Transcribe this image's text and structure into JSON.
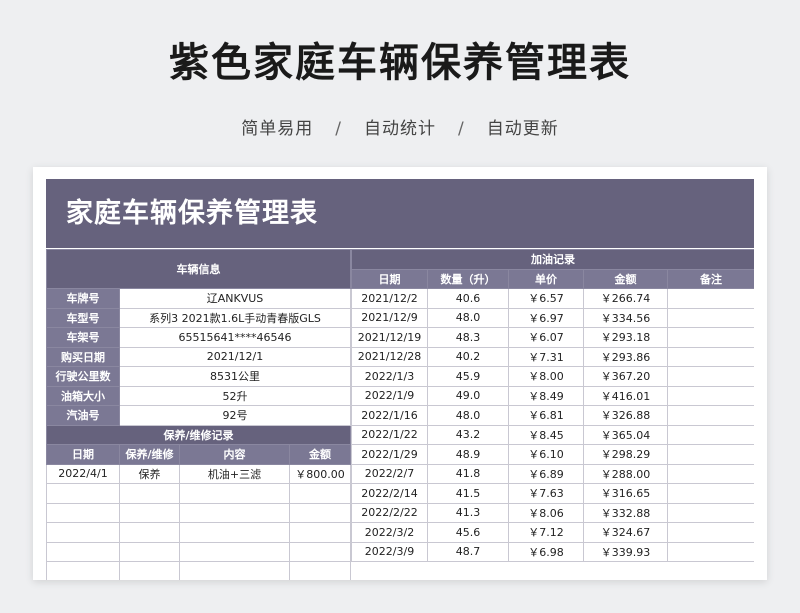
{
  "header": {
    "title": "紫色家庭车辆保养管理表",
    "features": [
      "简单易用",
      "自动统计",
      "自动更新"
    ],
    "separator": "/"
  },
  "sheet": {
    "title": "家庭车辆保养管理表",
    "vehicle_section": "车辆信息",
    "vehicle_info": [
      {
        "label": "车牌号",
        "value": "辽ANKVUS"
      },
      {
        "label": "车型号",
        "value": "系列3 2021款1.6L手动青春版GLS"
      },
      {
        "label": "车架号",
        "value": "65515641****46546"
      },
      {
        "label": "购买日期",
        "value": "2021/12/1"
      },
      {
        "label": "行驶公里数",
        "value": "8531公里"
      },
      {
        "label": "油箱大小",
        "value": "52升"
      },
      {
        "label": "汽油号",
        "value": "92号"
      }
    ],
    "maintenance_section": "保养/维修记录",
    "maintenance_headers": [
      "日期",
      "保养/维修",
      "内容",
      "金额"
    ],
    "maintenance_rows": [
      {
        "date": "2022/4/1",
        "type": "保养",
        "content": "机油+三滤",
        "amount": "￥800.00"
      }
    ],
    "fuel_section": "加油记录",
    "fuel_headers": [
      "日期",
      "数量（升）",
      "单价",
      "金额",
      "备注"
    ],
    "fuel_rows": [
      {
        "date": "2021/12/2",
        "qty": "40.6",
        "price": "￥6.57",
        "amount": "￥266.74"
      },
      {
        "date": "2021/12/9",
        "qty": "48.0",
        "price": "￥6.97",
        "amount": "￥334.56"
      },
      {
        "date": "2021/12/19",
        "qty": "48.3",
        "price": "￥6.07",
        "amount": "￥293.18"
      },
      {
        "date": "2021/12/28",
        "qty": "40.2",
        "price": "￥7.31",
        "amount": "￥293.86"
      },
      {
        "date": "2022/1/3",
        "qty": "45.9",
        "price": "￥8.00",
        "amount": "￥367.20"
      },
      {
        "date": "2022/1/9",
        "qty": "49.0",
        "price": "￥8.49",
        "amount": "￥416.01"
      },
      {
        "date": "2022/1/16",
        "qty": "48.0",
        "price": "￥6.81",
        "amount": "￥326.88"
      },
      {
        "date": "2022/1/22",
        "qty": "43.2",
        "price": "￥8.45",
        "amount": "￥365.04"
      },
      {
        "date": "2022/1/29",
        "qty": "48.9",
        "price": "￥6.10",
        "amount": "￥298.29"
      },
      {
        "date": "2022/2/7",
        "qty": "41.8",
        "price": "￥6.89",
        "amount": "￥288.00"
      },
      {
        "date": "2022/2/14",
        "qty": "41.5",
        "price": "￥7.63",
        "amount": "￥316.65"
      },
      {
        "date": "2022/2/22",
        "qty": "41.3",
        "price": "￥8.06",
        "amount": "￥332.88"
      },
      {
        "date": "2022/3/2",
        "qty": "45.6",
        "price": "￥7.12",
        "amount": "￥324.67"
      },
      {
        "date": "2022/3/9",
        "qty": "48.7",
        "price": "￥6.98",
        "amount": "￥339.93"
      }
    ]
  }
}
